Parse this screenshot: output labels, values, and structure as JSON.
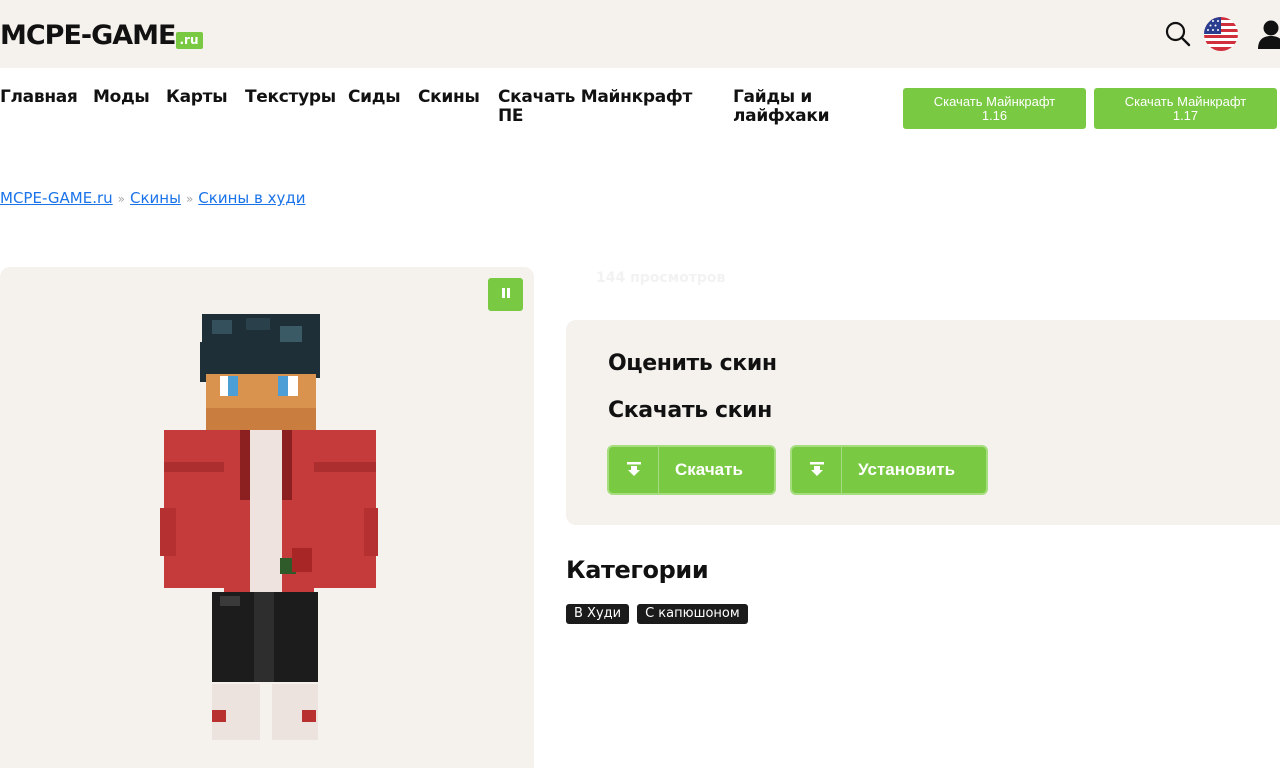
{
  "header": {
    "logo_text": "MCPE-GAME",
    "logo_suffix": ".ru"
  },
  "nav": {
    "items": [
      "Главная",
      "Моды",
      "Карты",
      "Текстуры",
      "Сиды",
      "Скины",
      "Скачать Майнкрафт ПЕ",
      "Гайды и лайфхаки"
    ],
    "buttons": [
      {
        "line1": "Скачать Майнкрафт",
        "line2": "1.16"
      },
      {
        "line1": "Скачать Майнкрафт",
        "line2": "1.17"
      }
    ]
  },
  "breadcrumb": {
    "items": [
      "MCPE-GAME.ru",
      "Скины",
      "Скины в худи"
    ],
    "separator": "»"
  },
  "skin": {
    "views": "144 просмотров"
  },
  "actions": {
    "rate_title": "Оценить скин",
    "download_title": "Скачать скин",
    "download_label": "Скачать",
    "install_label": "Установить"
  },
  "categories": {
    "title": "Категории",
    "tags": [
      "В Худи",
      "С капюшоном"
    ]
  },
  "colors": {
    "accent": "#7ac943",
    "panel_bg": "#f5f2ee",
    "link": "#1a73e8",
    "tag_bg": "#1b1b1b"
  },
  "icons": {
    "search": "search-icon",
    "flag": "us-flag-icon",
    "user": "user-icon",
    "pause": "pause-icon",
    "download": "download-icon"
  }
}
